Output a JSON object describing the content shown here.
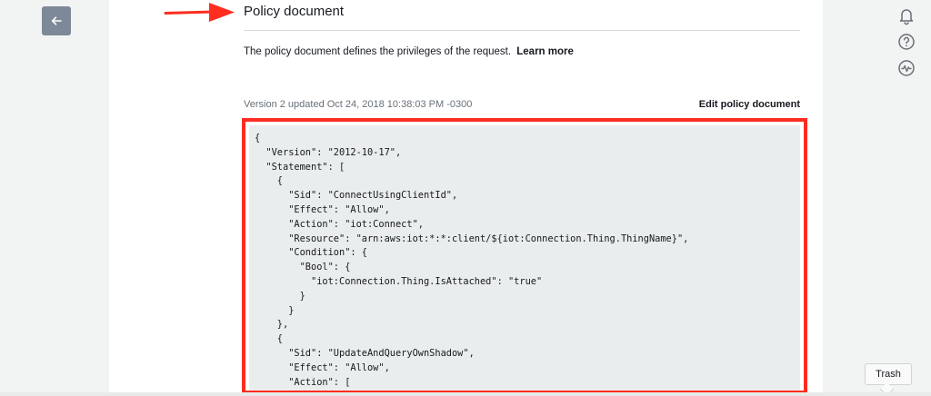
{
  "nav": {
    "back_icon": "arrow-left-icon"
  },
  "section": {
    "title": "Policy document",
    "description": "The policy document defines the privileges of the request.",
    "learn_more": "Learn more",
    "version_text": "Version 2 updated Oct 24, 2018 10:38:03 PM -0300",
    "edit_label": "Edit policy document"
  },
  "policy": {
    "code": "{\n  \"Version\": \"2012-10-17\",\n  \"Statement\": [\n    {\n      \"Sid\": \"ConnectUsingClientId\",\n      \"Effect\": \"Allow\",\n      \"Action\": \"iot:Connect\",\n      \"Resource\": \"arn:aws:iot:*:*:client/${iot:Connection.Thing.ThingName}\",\n      \"Condition\": {\n        \"Bool\": {\n          \"iot:Connection.Thing.IsAttached\": \"true\"\n        }\n      }\n    },\n    {\n      \"Sid\": \"UpdateAndQueryOwnShadow\",\n      \"Effect\": \"Allow\",\n      \"Action\": ["
  },
  "rail": {
    "icons": [
      "bell-icon",
      "help-icon",
      "activity-icon"
    ]
  },
  "trash": {
    "label": "Trash"
  },
  "colors": {
    "highlight": "#ff2d20",
    "back_button": "#7d8998"
  }
}
